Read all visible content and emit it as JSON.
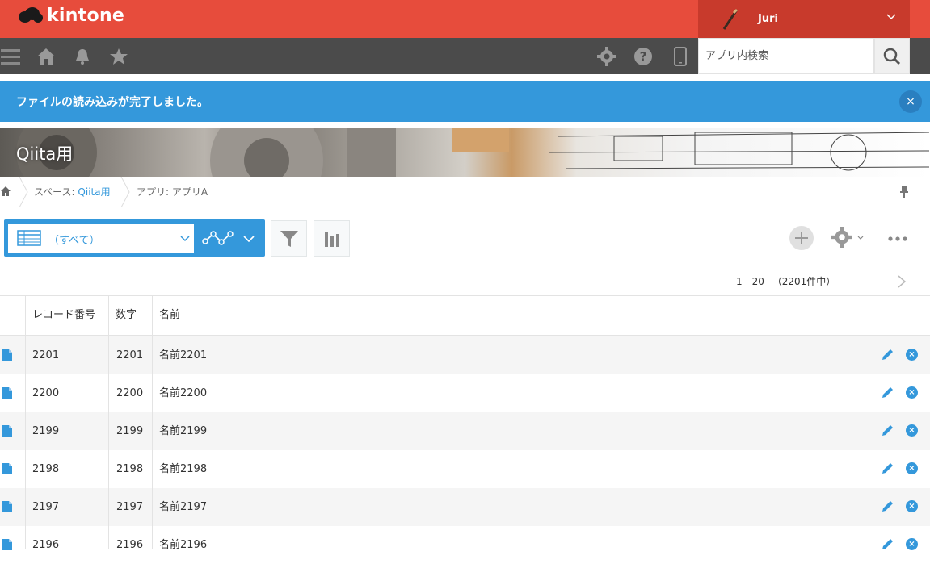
{
  "header": {
    "logo_text": "kintone",
    "user_name": "Juri"
  },
  "toolbar": {
    "search_placeholder": "アプリ内検索"
  },
  "notice": {
    "message": "ファイルの読み込みが完了しました。",
    "close": "×"
  },
  "banner": {
    "title": "Qiita用"
  },
  "breadcrumb": {
    "space_prefix": "スペース: ",
    "space_name": "Qiita用",
    "app": "アプリ: アプリA"
  },
  "view": {
    "selected": "（すべて）"
  },
  "pager": {
    "range": "1 - 20",
    "total": "（2201件中）"
  },
  "table": {
    "headers": [
      "レコード番号",
      "数字",
      "名前"
    ],
    "rows": [
      {
        "id": "2201",
        "num": "2201",
        "name": "名前2201"
      },
      {
        "id": "2200",
        "num": "2200",
        "name": "名前2200"
      },
      {
        "id": "2199",
        "num": "2199",
        "name": "名前2199"
      },
      {
        "id": "2198",
        "num": "2198",
        "name": "名前2198"
      },
      {
        "id": "2197",
        "num": "2197",
        "name": "名前2197"
      },
      {
        "id": "2196",
        "num": "2196",
        "name": "名前2196"
      }
    ]
  },
  "colors": {
    "header_red": "#e74c3c",
    "toolbar_gray": "#4b4b4b",
    "accent_blue": "#3498db"
  }
}
